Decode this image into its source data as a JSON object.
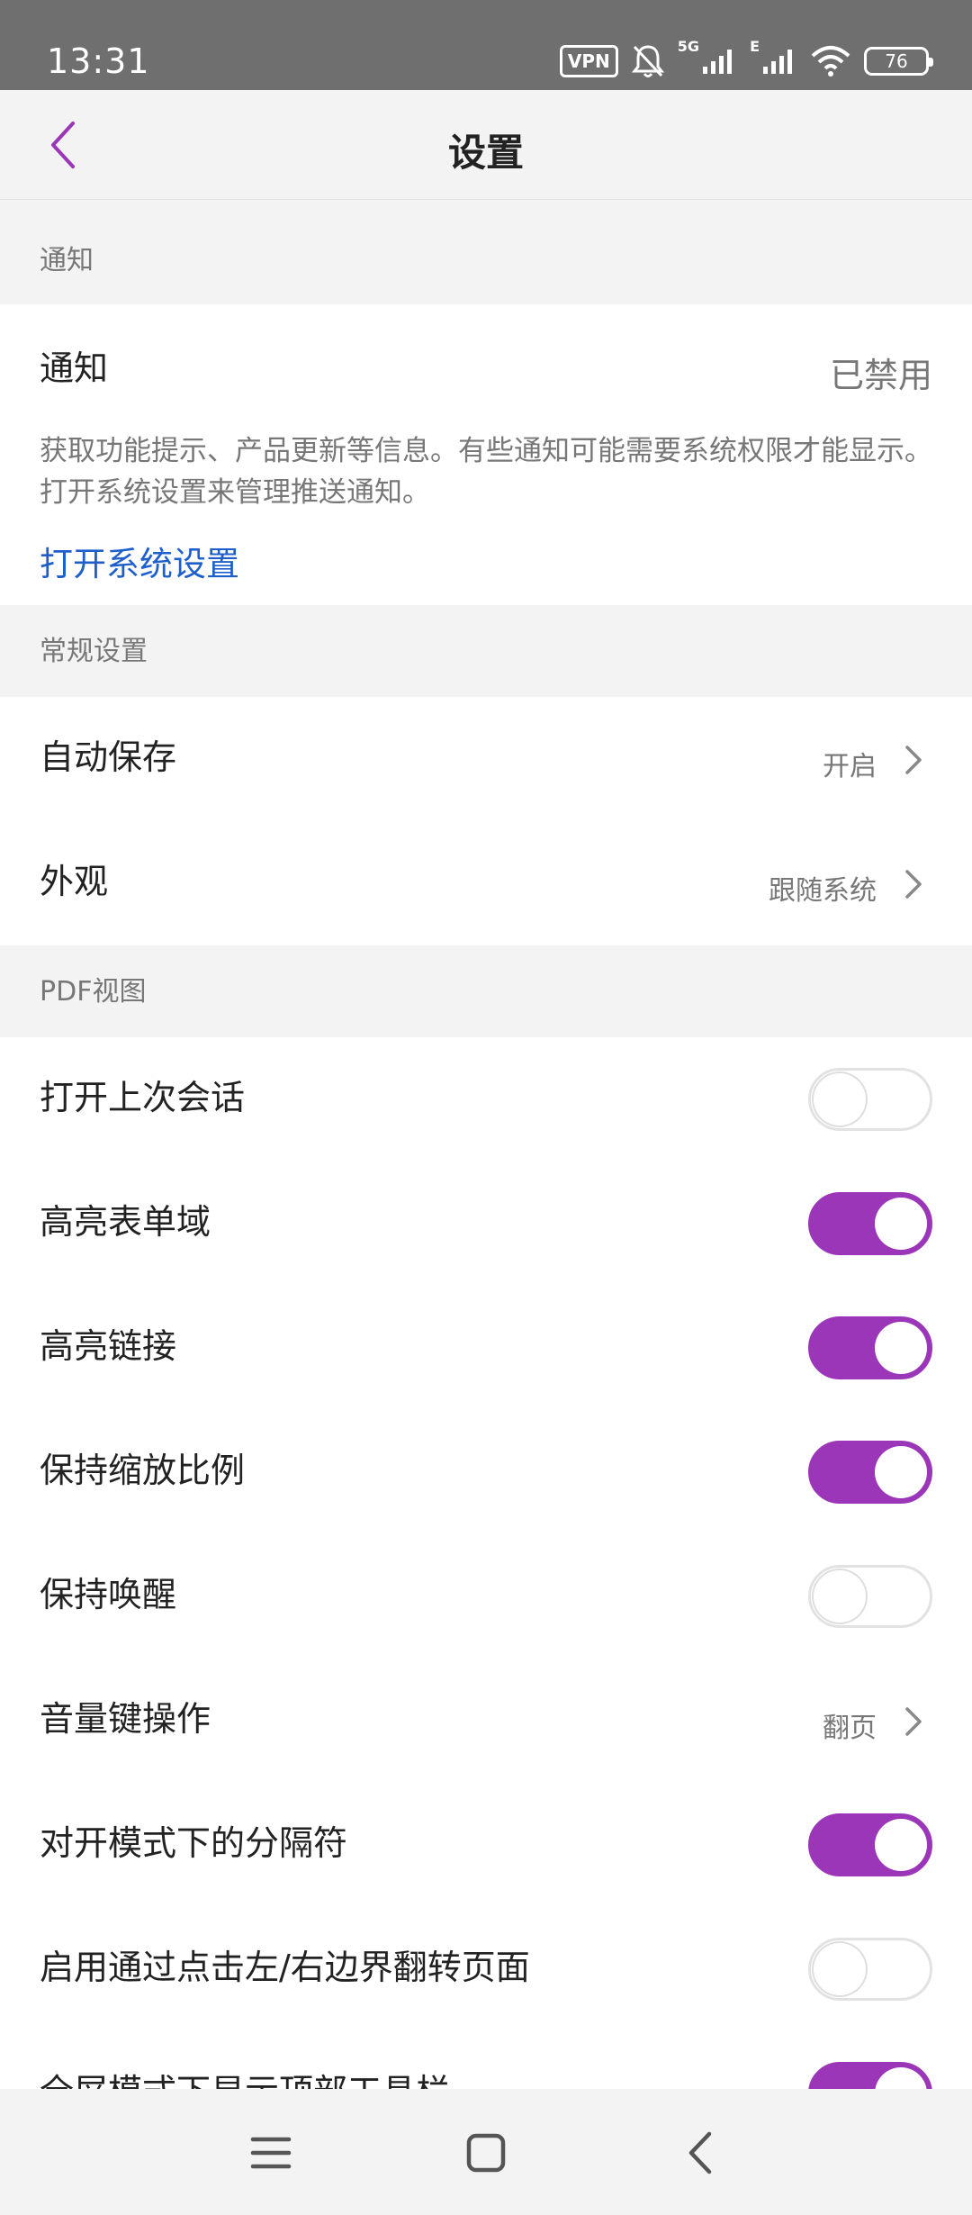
{
  "status_bar": {
    "time": "13:31",
    "vpn": "VPN",
    "network_5g": "5G",
    "network_e": "E",
    "battery": "76"
  },
  "app_bar": {
    "title": "设置",
    "back_icon": "chevron-left-icon",
    "accent_color": "#9b36b8"
  },
  "notifications_section": {
    "header": "通知",
    "row_label": "通知",
    "row_value": "已禁用",
    "description": "获取功能提示、产品更新等信息。有些通知可能需要系统权限才能显示。打开系统设置来管理推送通知。",
    "link": "打开系统设置",
    "link_color": "#1f5fcc"
  },
  "general_section": {
    "header": "常规设置",
    "items": [
      {
        "label": "自动保存",
        "value": "开启"
      },
      {
        "label": "外观",
        "value": "跟随系统"
      }
    ]
  },
  "pdf_section": {
    "header": "PDF视图",
    "items": [
      {
        "label": "打开上次会话",
        "toggle": false
      },
      {
        "label": "高亮表单域",
        "toggle": true
      },
      {
        "label": "高亮链接",
        "toggle": true
      },
      {
        "label": "保持缩放比例",
        "toggle": true
      },
      {
        "label": "保持唤醒",
        "toggle": false
      },
      {
        "label": "音量键操作",
        "value": "翻页"
      },
      {
        "label": "对开模式下的分隔符",
        "toggle": true
      },
      {
        "label": "启用通过点击左/右边界翻转页面",
        "toggle": false
      },
      {
        "label": "全屏模式下显示顶部工具栏",
        "toggle": true
      }
    ]
  },
  "nav_bar": {
    "icons": [
      "menu-icon",
      "home-square-icon",
      "back-icon"
    ]
  }
}
